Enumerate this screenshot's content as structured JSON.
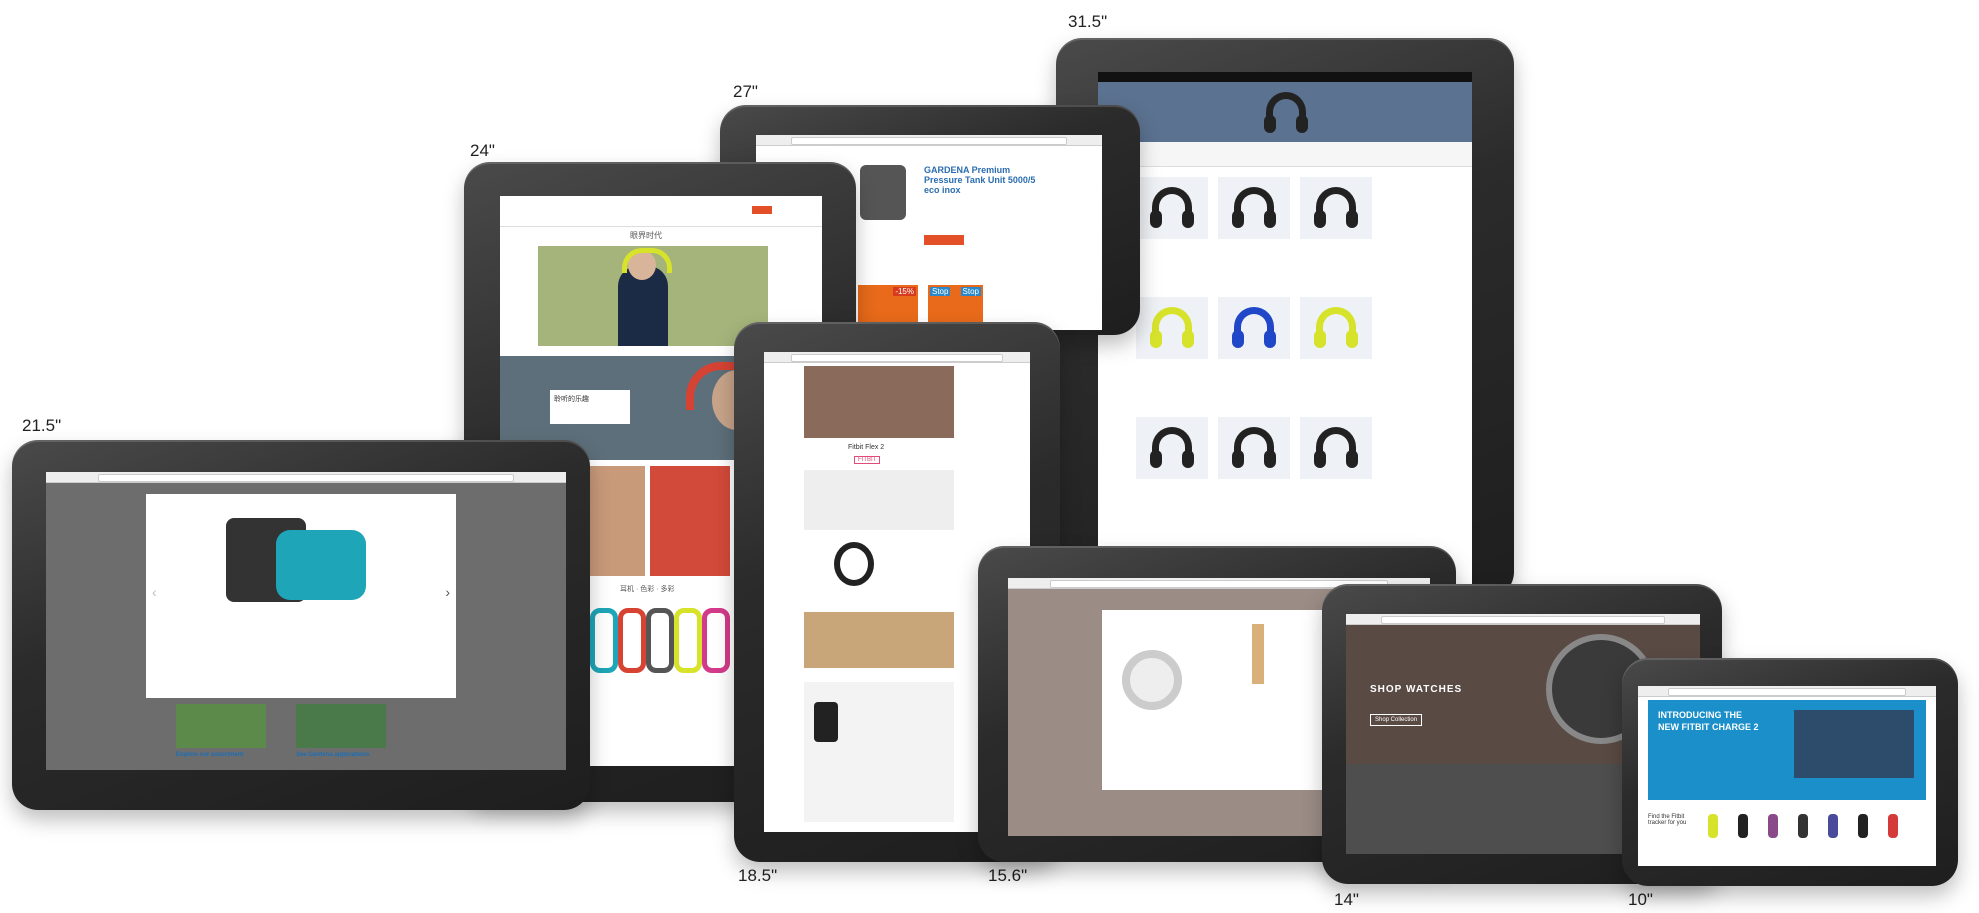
{
  "sizes": {
    "s315": "31.5\"",
    "s27": "27\"",
    "s24": "24\"",
    "s215": "21.5\"",
    "s185": "18.5\"",
    "s156": "15.6\"",
    "s14": "14\"",
    "s10": "10\""
  },
  "screens": {
    "d27": {
      "product_title": "GARDENA Premium Pressure Tank Unit 5000/5 eco inox",
      "badge1": "-15%",
      "badge2": "Stop",
      "badge3": "Stop"
    },
    "d24": {
      "cn_title": "眼界时代",
      "cn_section": "聆听的乐趣",
      "cn_row": "耳机 · 色彩 · 多彩"
    },
    "d215": {
      "caption1": "Explore our assortment",
      "caption2": "See Gardena applications"
    },
    "d185": {
      "brand": "Fitbit Flex 2",
      "tag": "FITBIT"
    },
    "d14": {
      "heading": "SHOP WATCHES",
      "button": "Shop Collection"
    },
    "d10": {
      "heading_line1": "INTRODUCING THE",
      "heading_line2": "NEW FITBIT CHARGE 2",
      "side_text": "Find the Fitbit tracker for you"
    }
  },
  "colors": {
    "accent_orange": "#e34f26",
    "fitbit_blue": "#1a8fc9",
    "tealpump": "#1ea6b8",
    "headphone_yellow": "#d7e22b",
    "headphone_blue": "#1f47c8",
    "hero_slate": "#5b7290"
  }
}
